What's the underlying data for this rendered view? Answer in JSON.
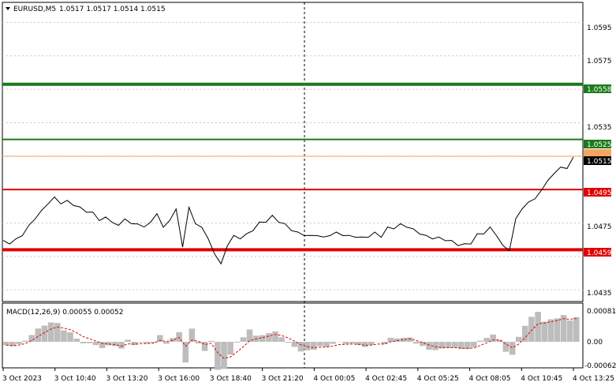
{
  "header": {
    "symbol_text": "EURUSD,M5",
    "ohlc_text": "1.0517 1.0517 1.0514 1.0515"
  },
  "macd": {
    "label": "MACD(12,26,9) 0.00055 0.00052",
    "scale": [
      "0.00081",
      "0.00",
      "-0.00062"
    ],
    "histogram_color": "#bdbdbd",
    "signal_color": "#e00000"
  },
  "price_axis": {
    "labels": [
      "1.0595",
      "1.0575",
      "1.0535",
      "1.0515",
      "1.0495",
      "1.0475",
      "1.0455",
      "1.0435"
    ]
  },
  "levels": [
    {
      "price": 1.0558,
      "label": "1.0558",
      "color": "#1a7a1a",
      "kind": "thick"
    },
    {
      "price": 1.0525,
      "label": "1.0525",
      "color": "#1a7a1a",
      "kind": "thin"
    },
    {
      "price": 1.0495,
      "label": "1.0495",
      "color": "#e00000",
      "kind": "thin"
    },
    {
      "price": 1.0459,
      "label": "1.0459",
      "color": "#e00000",
      "kind": "thick"
    }
  ],
  "current_price": {
    "label": "1.0515",
    "bg": "#000000"
  },
  "time_axis": {
    "labels": [
      "3 Oct 2023",
      "3 Oct 10:40",
      "3 Oct 13:20",
      "3 Oct 16:00",
      "3 Oct 18:40",
      "3 Oct 21:20",
      "4 Oct 00:05",
      "4 Oct 02:45",
      "4 Oct 05:25",
      "4 Oct 08:05",
      "4 Oct 10:45",
      "4 Oct 13:25"
    ]
  },
  "chart_data": {
    "type": "line",
    "title": "EURUSD,M5",
    "x_labels": [
      "3 Oct 2023",
      "3 Oct 10:40",
      "3 Oct 13:20",
      "3 Oct 16:00",
      "3 Oct 18:40",
      "3 Oct 21:20",
      "4 Oct 00:05",
      "4 Oct 02:45",
      "4 Oct 05:25",
      "4 Oct 08:05",
      "4 Oct 10:45",
      "4 Oct 13:25"
    ],
    "ylim": [
      1.0428,
      1.0607
    ],
    "series": [
      {
        "values": [
          1.0464,
          1.0463,
          1.0465,
          1.0468,
          1.0473,
          1.0478,
          1.0482,
          1.0487,
          1.049,
          1.0487,
          1.0488,
          1.0486,
          1.0484,
          1.0482,
          1.0481,
          1.0477,
          1.0478,
          1.0476,
          1.0473,
          1.0478,
          1.0474,
          1.0475,
          1.0472,
          1.0476,
          1.048,
          1.0473,
          1.0476,
          1.0484,
          1.046,
          1.0485,
          1.0474,
          1.0473,
          1.0465,
          1.0457,
          1.045,
          1.0462,
          1.0467,
          1.0466,
          1.0468,
          1.0471,
          1.0475,
          1.0476,
          1.0479,
          1.0476,
          1.0474,
          1.0471,
          1.0469,
          1.0468,
          1.0467,
          1.0468,
          1.0466,
          1.0468,
          1.0469,
          1.0468,
          1.0467,
          1.0467,
          1.0466,
          1.0467,
          1.0469,
          1.0467,
          1.0472,
          1.0472,
          1.0474,
          1.0473,
          1.0471,
          1.0469,
          1.0467,
          1.0466,
          1.0466,
          1.0465,
          1.0464,
          1.0462,
          1.0462,
          1.0463,
          1.0468,
          1.0469,
          1.0472,
          1.0468,
          1.0461,
          1.0459,
          1.0477,
          1.0484,
          1.0487,
          1.049,
          1.0494,
          1.0501,
          1.0504,
          1.0509,
          1.0507,
          1.0515
        ]
      }
    ]
  }
}
